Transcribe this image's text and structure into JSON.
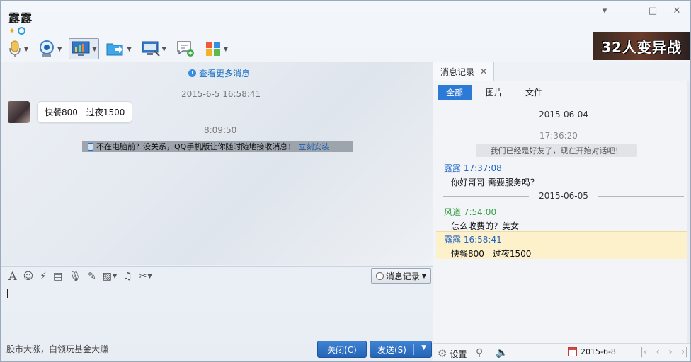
{
  "header": {
    "contact_name": "露露"
  },
  "window_controls": {
    "dropdown": "▾",
    "minimize": "–",
    "maximize": "□",
    "close": "✕"
  },
  "toolbar": {
    "items": [
      "voice-call",
      "video-call",
      "share-screen",
      "send-file",
      "remote-desktop",
      "create-discussion",
      "apps"
    ]
  },
  "ad_banner": {
    "text": "32人变异战"
  },
  "chat": {
    "more_messages": "查看更多消息",
    "timestamp_1": "2015-6-5 16:58:41",
    "message_1": "快餐800　过夜1500",
    "timestamp_2": "8:09:50",
    "tip_text": "不在电脑前？没关系，QQ手机版让你随时随地接收消息！",
    "tip_link": "立刻安装"
  },
  "input_toolbar": {
    "history_button": "消息记录"
  },
  "bottom": {
    "ad_text": "股市大涨，白领玩基金大赚",
    "close_label": "关闭(C)",
    "send_label": "发送(S)"
  },
  "history_panel": {
    "tab_label": "消息记录",
    "filters": [
      "全部",
      "图片",
      "文件"
    ],
    "date_1": "2015-06-04",
    "time_1": "17:36:20",
    "sys_msg": "我们已经是好友了，现在开始对话吧！",
    "msg_a_head": "露露 17:37:08",
    "msg_a_body": "你好哥哥 需要服务吗？",
    "date_2": "2015-06-05",
    "msg_b_head": "风道 7:54:00",
    "msg_b_body": "怎么收费的？美女",
    "msg_c_head": "露露 16:58:41",
    "msg_c_body": "快餐800　过夜1500",
    "settings_label": "设置",
    "current_date": "2015-6-8"
  },
  "colors": {
    "accent": "#2d7ad6",
    "name_blue": "#1e63c4",
    "name_green": "#3aa04a",
    "highlight": "#fdf1cc"
  }
}
